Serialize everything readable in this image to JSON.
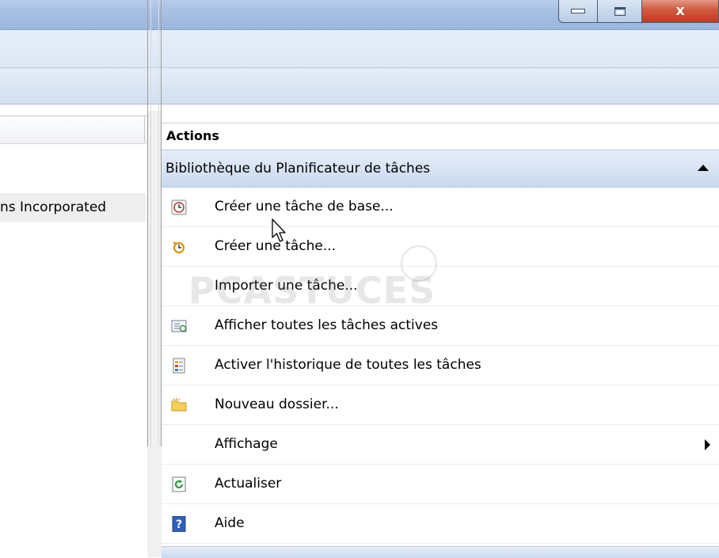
{
  "window": {
    "minimize_icon": "minimize-icon",
    "maximize_icon": "maximize-icon",
    "close_icon": "close-icon",
    "close_color": "#c8442a"
  },
  "left_pane": {
    "visible_row_text": "ns Incorporated"
  },
  "actions": {
    "header": "Actions",
    "section_title": "Bibliothèque du Planificateur de tâches",
    "items": [
      {
        "label": "Créer une tâche de base...",
        "icon": "clock-task-icon"
      },
      {
        "label": "Créer une tâche...",
        "icon": "clock-icon"
      },
      {
        "label": "Importer une tâche...",
        "icon": ""
      },
      {
        "label": "Afficher toutes les tâches actives",
        "icon": "task-list-icon"
      },
      {
        "label": "Activer l'historique de toutes les tâches",
        "icon": "history-icon"
      },
      {
        "label": "Nouveau dossier...",
        "icon": "folder-icon"
      },
      {
        "label": "Affichage",
        "icon": "",
        "submenu": true
      },
      {
        "label": "Actualiser",
        "icon": "refresh-icon"
      },
      {
        "label": "Aide",
        "icon": "help-icon"
      }
    ]
  },
  "watermark": {
    "text": "PCASTUCES"
  },
  "colors": {
    "section_header": "#d4e1f2",
    "titlebar": "#a9c1e3"
  }
}
